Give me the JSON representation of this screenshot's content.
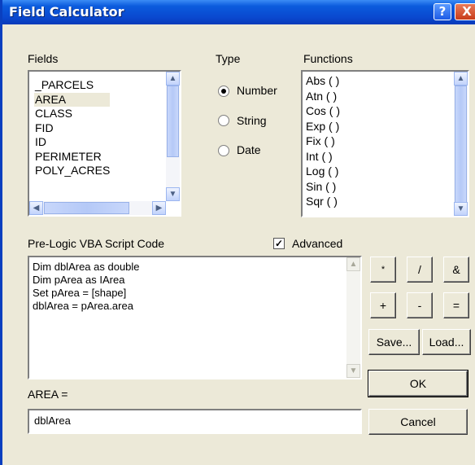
{
  "window": {
    "title": "Field Calculator",
    "help_label": "?",
    "close_label": "X"
  },
  "fields": {
    "label": "Fields",
    "items": [
      "_PARCELS",
      "AREA",
      "CLASS",
      "FID",
      "ID",
      "PERIMETER",
      "POLY_ACRES"
    ],
    "selected": "AREA"
  },
  "type": {
    "label": "Type",
    "options": [
      "Number",
      "String",
      "Date"
    ],
    "selected": "Number"
  },
  "functions": {
    "label": "Functions",
    "items": [
      "Abs ( )",
      "Atn ( )",
      "Cos ( )",
      "Exp ( )",
      "Fix ( )",
      "Int ( )",
      "Log ( )",
      "Sin ( )",
      "Sqr ( )"
    ]
  },
  "script": {
    "label": "Pre-Logic VBA Script Code",
    "advanced_label": "Advanced",
    "advanced_checked": true,
    "lines": [
      "Dim dblArea as double",
      "Dim pArea as IArea",
      "Set pArea = [shape]",
      "dblArea = pArea.area"
    ]
  },
  "operators": [
    "*",
    "/",
    "&",
    "+",
    "-",
    "="
  ],
  "buttons": {
    "save": "Save...",
    "load": "Load...",
    "ok": "OK",
    "cancel": "Cancel"
  },
  "expression": {
    "label": "AREA =",
    "value": "dblArea"
  },
  "icons": {
    "scroll_up": "▲",
    "scroll_down": "▼",
    "scroll_left": "◀",
    "scroll_right": "▶",
    "check": "✓"
  }
}
